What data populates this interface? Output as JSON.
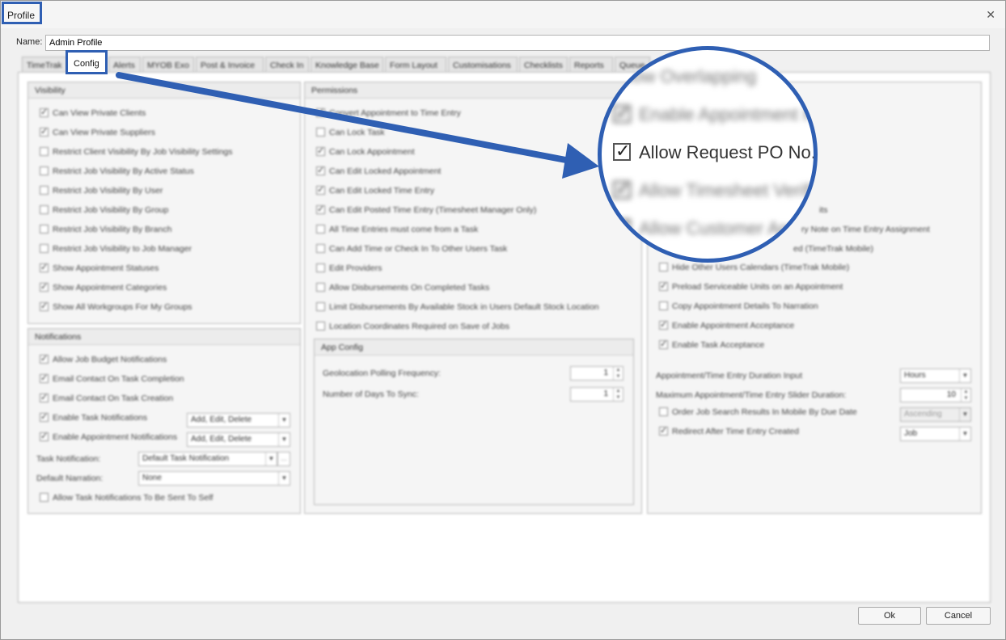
{
  "window": {
    "title": "Profile",
    "close_glyph": "✕"
  },
  "name": {
    "label": "Name:",
    "value": "Admin Profile"
  },
  "tabs": [
    "TimeTrak",
    "Config",
    "Alerts",
    "MYOB Exo",
    "Post & Invoice",
    "Check In",
    "Knowledge Base",
    "Form Layout",
    "Customisations",
    "Checklists",
    "Reports",
    "Queue"
  ],
  "visibility": {
    "title": "Visibility",
    "items": [
      {
        "label": "Can View Private Clients",
        "checked": true
      },
      {
        "label": "Can View Private Suppliers",
        "checked": true
      },
      {
        "label": "Restrict Client Visibility By Job Visibility Settings",
        "checked": false
      },
      {
        "label": "Restrict Job Visibility By Active Status",
        "checked": false
      },
      {
        "label": "Restrict Job Visibility By User",
        "checked": false
      },
      {
        "label": "Restrict Job Visibility By Group",
        "checked": false
      },
      {
        "label": "Restrict Job Visibility By Branch",
        "checked": false
      },
      {
        "label": "Restrict Job Visibility to Job Manager",
        "checked": false
      },
      {
        "label": "Show Appointment Statuses",
        "checked": true
      },
      {
        "label": "Show Appointment Categories",
        "checked": true
      },
      {
        "label": "Show All Workgroups For My Groups",
        "checked": true
      }
    ]
  },
  "notifications": {
    "title": "Notifications",
    "items": [
      {
        "label": "Allow Job Budget Notifications",
        "checked": true
      },
      {
        "label": "Email Contact On Task Completion",
        "checked": true
      },
      {
        "label": "Email Contact On Task Creation",
        "checked": true
      },
      {
        "label": "Enable Task Notifications",
        "checked": true
      },
      {
        "label": "Enable Appointment Notifications",
        "checked": true
      }
    ],
    "task_notif_combo": "Add, Edit, Delete",
    "appt_notif_combo": "Add, Edit, Delete",
    "task_notification_label": "Task Notification:",
    "task_notification_value": "Default Task Notification",
    "default_narration_label": "Default Narration:",
    "default_narration_value": "None",
    "self_label": "Allow Task Notifications To Be Sent To Self",
    "self_checked": false
  },
  "permissions": {
    "title": "Permissions",
    "items": [
      {
        "label": "Convert Appointment to Time Entry",
        "checked": true
      },
      {
        "label": "Can Lock Task",
        "checked": false
      },
      {
        "label": "Can Lock Appointment",
        "checked": true
      },
      {
        "label": "Can Edit Locked Appointment",
        "checked": true
      },
      {
        "label": "Can Edit Locked Time Entry",
        "checked": true
      },
      {
        "label": "Can Edit Posted Time Entry (Timesheet Manager Only)",
        "checked": true
      },
      {
        "label": "All Time Entries must come from a Task",
        "checked": false
      },
      {
        "label": "Can Add Time or Check In To Other Users Task",
        "checked": false
      },
      {
        "label": "Edit Providers",
        "checked": false
      },
      {
        "label": "Allow Disbursements On Completed Tasks",
        "checked": false
      },
      {
        "label": "Limit Disbursements By Available Stock in Users Default Stock Location",
        "checked": false
      },
      {
        "label": "Location Coordinates Required on Save of Jobs",
        "checked": false
      }
    ]
  },
  "app_config": {
    "title": "App Config",
    "geo_label": "Geolocation Polling Frequency:",
    "geo_value": "1",
    "days_label": "Number of Days To Sync:",
    "days_value": "1"
  },
  "right_panel": {
    "items_top": [
      {
        "label": "its",
        "checked": false
      },
      {
        "label": "ry Note on Time Entry Assignment",
        "checked": false
      },
      {
        "label": "ed (TimeTrak Mobile)",
        "checked": false
      }
    ],
    "items": [
      {
        "label": "Hide Other Users Calendars (TimeTrak Mobile)",
        "checked": false
      },
      {
        "label": "Preload Serviceable Units on an Appointment",
        "checked": true
      },
      {
        "label": "Copy Appointment Details To Narration",
        "checked": false
      },
      {
        "label": "Enable Appointment Acceptance",
        "checked": true
      },
      {
        "label": "Enable Task Acceptance",
        "checked": true
      }
    ],
    "duration_input_label": "Appointment/Time Entry Duration Input",
    "duration_input_value": "Hours",
    "slider_label": "Maximum Appointment/Time Entry Slider Duration:",
    "slider_value": "10",
    "order_label": "Order Job Search Results In Mobile By Due Date",
    "order_checked": false,
    "order_value": "Ascending",
    "redirect_label": "Redirect After Time Entry Created",
    "redirect_checked": true,
    "redirect_value": "Job"
  },
  "magnifier": {
    "rows": [
      {
        "label": "Allow Overlapping",
        "blur": true,
        "checked": false
      },
      {
        "label": "Enable Appointment R",
        "blur": true,
        "checked": true
      },
      {
        "label": "Allow Request PO No.",
        "blur": false,
        "checked": true
      },
      {
        "label": "Allow Timesheet Verifi",
        "blur": true,
        "checked": true
      },
      {
        "label": "Allow Customer App",
        "blur": true,
        "checked": true
      }
    ]
  },
  "buttons": {
    "ok": "Ok",
    "cancel": "Cancel"
  },
  "colors": {
    "highlight": "#2f5fb3"
  }
}
